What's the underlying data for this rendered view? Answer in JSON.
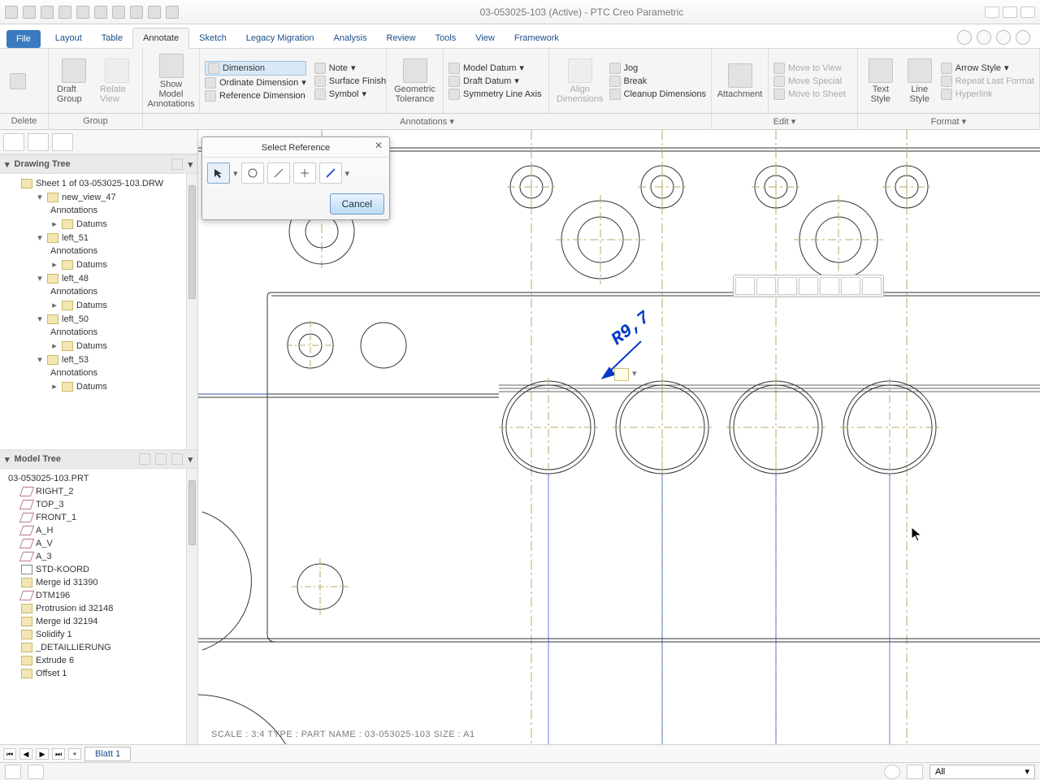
{
  "window": {
    "title": "03-053025-103 (Active) - PTC Creo Parametric"
  },
  "tabs": {
    "file": "File",
    "items": [
      "Layout",
      "Table",
      "Annotate",
      "Sketch",
      "Legacy Migration",
      "Analysis",
      "Review",
      "Tools",
      "View",
      "Framework"
    ],
    "active": "Annotate"
  },
  "ribbon": {
    "delete": "Delete",
    "draft_group": "Draft Group",
    "relate_view": "Relate View",
    "show_model_annotations": "Show Model Annotations",
    "dimension": "Dimension",
    "ordinate_dimension": "Ordinate Dimension",
    "reference_dimension": "Reference Dimension",
    "note": "Note",
    "surface_finish": "Surface Finish",
    "symbol": "Symbol",
    "geometric_tolerance": "Geometric Tolerance",
    "model_datum": "Model Datum",
    "draft_datum": "Draft Datum",
    "symmetry_line_axis": "Symmetry Line Axis",
    "align_dimensions": "Align Dimensions",
    "jog": "Jog",
    "break": "Break",
    "cleanup_dimensions": "Cleanup Dimensions",
    "attachment": "Attachment",
    "move_to_view": "Move to View",
    "move_special": "Move Special",
    "move_to_sheet": "Move to Sheet",
    "text_style": "Text Style",
    "line_style": "Line Style",
    "arrow_style": "Arrow Style",
    "repeat_last_format": "Repeat Last Format",
    "hyperlink": "Hyperlink"
  },
  "group_labels": {
    "delete": "Delete",
    "group": "Group",
    "annotations": "Annotations",
    "edit": "Edit",
    "format": "Format"
  },
  "dialog": {
    "title": "Select Reference",
    "cancel": "Cancel"
  },
  "drawing_tree": {
    "title": "Drawing Tree",
    "root": "Sheet 1 of 03-053025-103.DRW",
    "views": [
      {
        "name": "new_view_47",
        "children": [
          "Annotations",
          "Datums"
        ]
      },
      {
        "name": "left_51",
        "children": [
          "Annotations",
          "Datums"
        ]
      },
      {
        "name": "left_48",
        "children": [
          "Annotations",
          "Datums"
        ]
      },
      {
        "name": "left_50",
        "children": [
          "Annotations",
          "Datums"
        ]
      },
      {
        "name": "left_53",
        "children": [
          "Annotations",
          "Datums"
        ]
      }
    ]
  },
  "model_tree": {
    "title": "Model Tree",
    "root": "03-053025-103.PRT",
    "items": [
      "RIGHT_2",
      "TOP_3",
      "FRONT_1",
      "A_H",
      "A_V",
      "A_3",
      "STD-KOORD",
      "Merge id 31390",
      "DTM196",
      "Protrusion id 32148",
      "Merge id 32194",
      "Solidify 1",
      "_DETAILLIERUNG",
      "Extrude 6",
      "Offset 1"
    ]
  },
  "canvas": {
    "dimension_text": "R9,7",
    "info_line": "SCALE : 3:4     TYPE : PART     NAME : 03-053025-103     SIZE : A1"
  },
  "sheetbar": {
    "add": "+",
    "tab": "Blatt 1"
  },
  "statusbar": {
    "filter": "All"
  }
}
